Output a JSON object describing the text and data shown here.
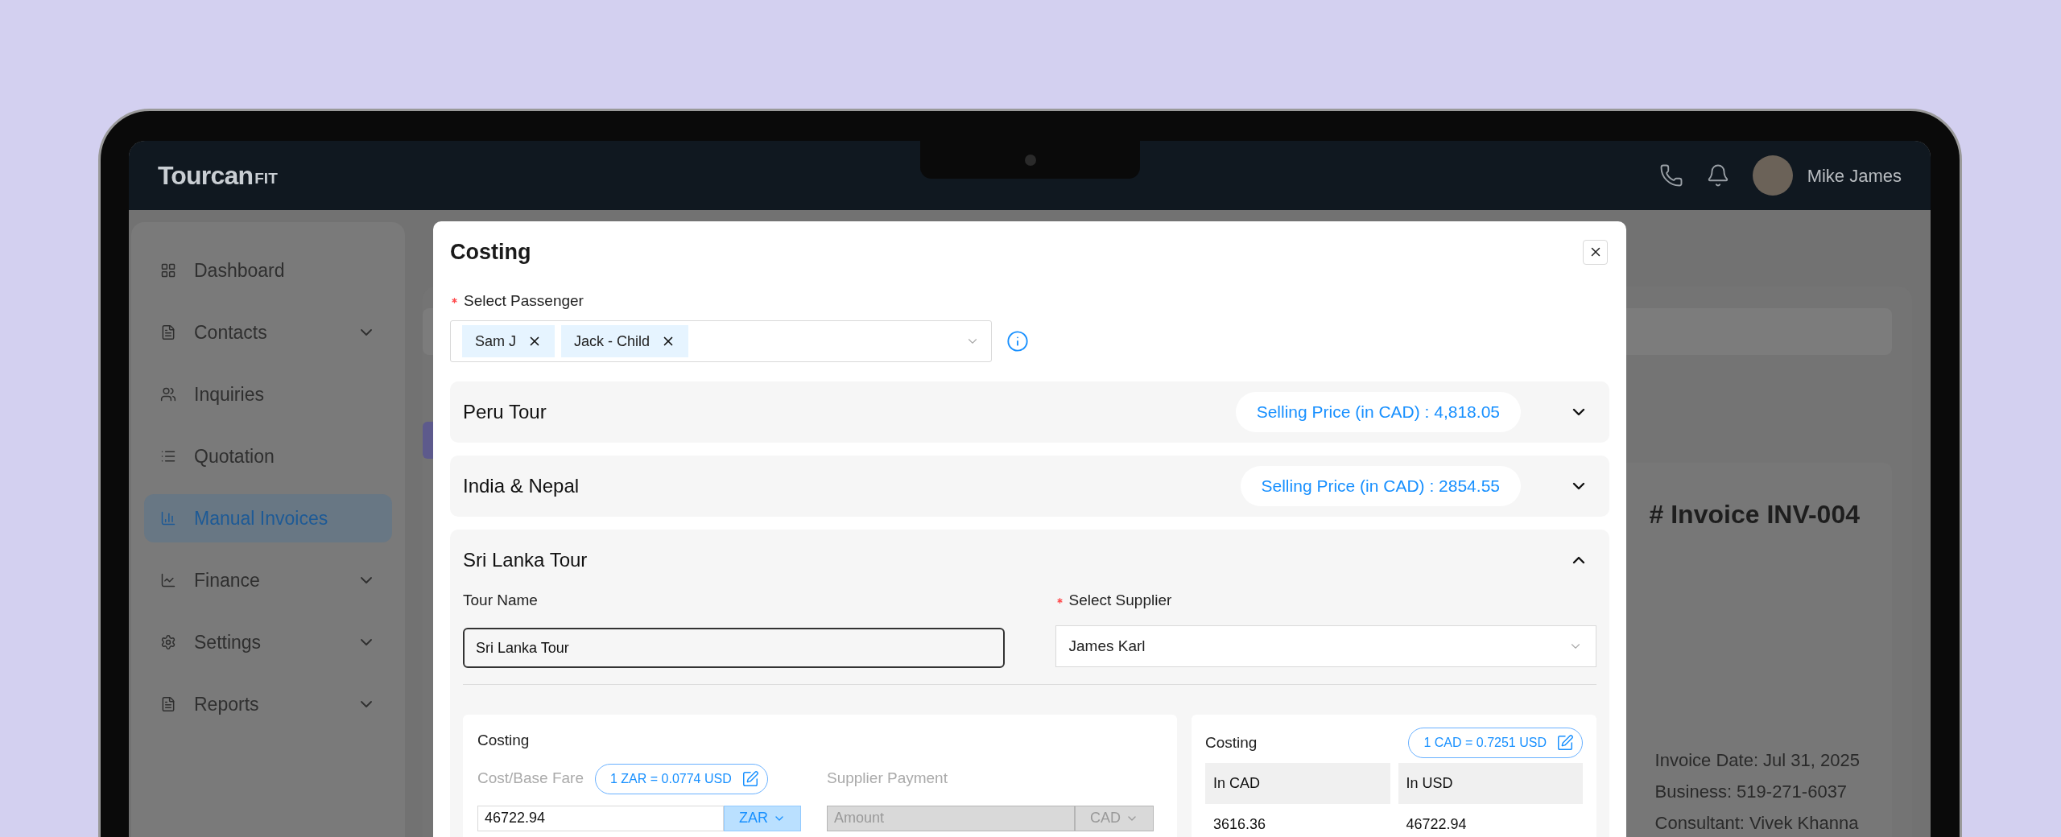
{
  "header": {
    "logo": "Tourcan",
    "logo_suffix": "FIT",
    "user_name": "Mike James"
  },
  "sidebar": {
    "items": [
      {
        "label": "Dashboard",
        "selected": false,
        "expandable": false
      },
      {
        "label": "Contacts",
        "selected": false,
        "expandable": true
      },
      {
        "label": "Inquiries",
        "selected": false,
        "expandable": false
      },
      {
        "label": "Quotation",
        "selected": false,
        "expandable": false
      },
      {
        "label": "Manual Invoices",
        "selected": true,
        "expandable": false
      },
      {
        "label": "Finance",
        "selected": false,
        "expandable": true
      },
      {
        "label": "Settings",
        "selected": false,
        "expandable": true
      },
      {
        "label": "Reports",
        "selected": false,
        "expandable": true
      }
    ]
  },
  "invoice": {
    "title": "# Invoice INV-004",
    "details": [
      "Invoice Date: Jul 31, 2025",
      "Business: 519-271-6037",
      "Consultant: Vivek Khanna"
    ]
  },
  "modal": {
    "title": "Costing",
    "passenger_field": {
      "label": "Select Passenger",
      "required": true,
      "tags": [
        "Sam J",
        "Jack - Child"
      ]
    },
    "tours": [
      {
        "name": "Peru Tour",
        "selling_price": "Selling Price (in CAD) : 4,818.05",
        "expanded": false
      },
      {
        "name": "India & Nepal",
        "selling_price": "Selling Price (in CAD) : 2854.55",
        "expanded": false
      },
      {
        "name": "Sri Lanka Tour",
        "expanded": true
      }
    ],
    "tour_details": {
      "tour_name": {
        "label": "Tour Name",
        "value": "Sri Lanka Tour"
      },
      "supplier": {
        "label": "Select Supplier",
        "value": "James Karl",
        "required": true
      },
      "costing": {
        "title": "Costing",
        "cost_label": "Cost/Base Fare",
        "rate": "1 ZAR = 0.0774 USD",
        "cost_value": "46722.94",
        "cost_currency": "ZAR",
        "payment_label": "Supplier Payment",
        "payment_placeholder": "Amount",
        "payment_currency": "CAD",
        "payment_disabled": true
      },
      "summary": {
        "title": "Costing",
        "rate": "1 CAD = 0.7251 USD",
        "columns": [
          "In CAD",
          "In USD"
        ],
        "rows": [
          [
            "3616.36",
            "46722.94"
          ]
        ]
      }
    }
  }
}
